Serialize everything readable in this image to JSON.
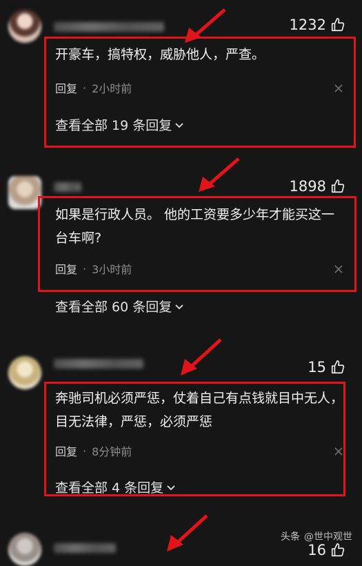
{
  "comments": [
    {
      "likes": "1232",
      "text": "开豪车，搞特权，威胁他人，严查。",
      "reply_label": "回复",
      "time": "2小时前",
      "view_all": "查看全部 19 条回复"
    },
    {
      "likes": "1898",
      "text": "如果是行政人员。 他的工资要多少年才能买这一台车啊?",
      "reply_label": "回复",
      "time": "3小时前",
      "view_all": "查看全部 60 条回复"
    },
    {
      "likes": "15",
      "text": "奔驰司机必须严惩，仗着自己有点钱就目中无人，目无法律，严惩，必须严惩",
      "reply_label": "回复",
      "time": "8分钟前",
      "view_all": "查看全部 4 条回复"
    },
    {
      "likes": "16"
    }
  ],
  "separator": "·",
  "watermark": {
    "brand": "头条",
    "account": "@世中观世"
  },
  "colors": {
    "background": "#161616",
    "highlight": "#e0141a",
    "meta": "#8d8d8d"
  },
  "icons": {
    "like": "thumbs-up-icon",
    "close": "close-icon",
    "expand": "chevron-down-icon"
  }
}
